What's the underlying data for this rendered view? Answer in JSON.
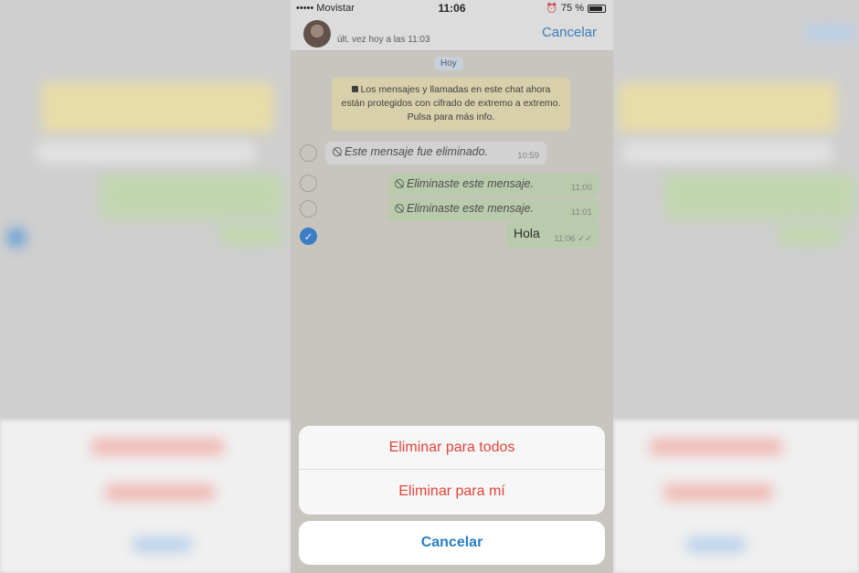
{
  "status": {
    "carrier": "•••••  Movistar",
    "time": "11:06",
    "battery": "75 %",
    "battery_level_percent": 75
  },
  "header": {
    "last_seen": "últ. vez hoy a las 11:03",
    "cancel_label": "Cancelar"
  },
  "chat": {
    "day_label": "Hoy",
    "notice": "Los mensajes y llamadas en este chat ahora están protegidos con cifrado de extremo a extremo. Pulsa para más info.",
    "messages": [
      {
        "text": "Este mensaje fue eliminado.",
        "time": "10:59",
        "direction": "in",
        "deleted": true,
        "selected": false
      },
      {
        "text": "Eliminaste este mensaje.",
        "time": "11:00",
        "direction": "out",
        "deleted": true,
        "selected": false
      },
      {
        "text": "Eliminaste este mensaje.",
        "time": "11:01",
        "direction": "out",
        "deleted": true,
        "selected": false
      },
      {
        "text": "Hola",
        "time": "11:06",
        "direction": "out",
        "deleted": false,
        "selected": true,
        "ticks": "✓✓"
      }
    ]
  },
  "action_sheet": {
    "delete_for_all": "Eliminar para todos",
    "delete_for_me": "Eliminar para mí",
    "cancel": "Cancelar"
  },
  "colors": {
    "accent": "#2c7fc9",
    "destructive": "#e0453a",
    "outgoing_bubble": "#c9dcb8",
    "notice_bg": "#ede3b5"
  }
}
